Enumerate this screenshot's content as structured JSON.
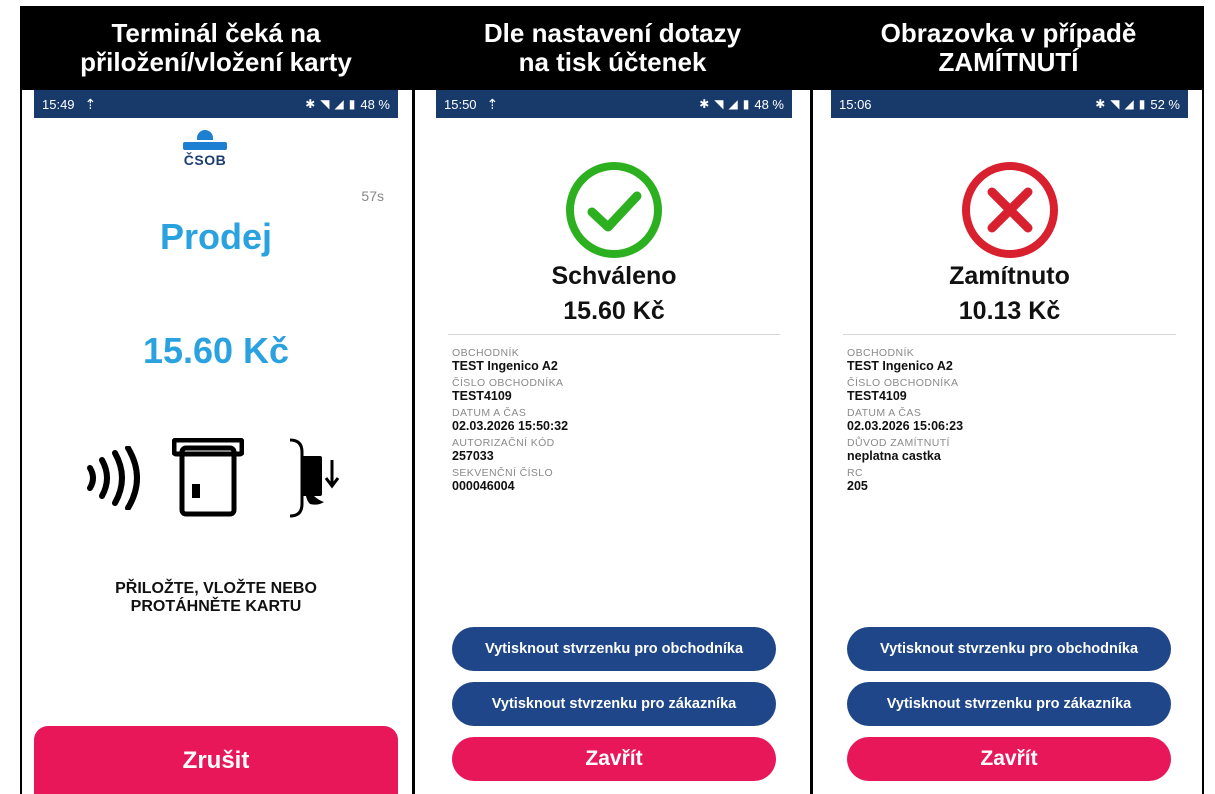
{
  "headers": {
    "col1": [
      "Terminál čeká na",
      "přiložení/vložení karty"
    ],
    "col2": [
      "Dle nastavení dotazy",
      "na tisk účtenek"
    ],
    "col3": [
      "Obrazovka v případě",
      "ZAMÍTNUTÍ"
    ]
  },
  "screen1": {
    "status": {
      "time": "15:49",
      "battery": "48 %"
    },
    "logo_text": "ČSOB",
    "timer": "57s",
    "title": "Prodej",
    "amount": "15.60 Kč",
    "instruction_line1": "PŘILOŽTE, VLOŽTE NEBO",
    "instruction_line2": "PROTÁHNĚTE KARTU",
    "cancel_label": "Zrušit"
  },
  "screen2": {
    "status": {
      "time": "15:50",
      "battery": "48 %"
    },
    "result_title": "Schváleno",
    "amount": "15.60 Kč",
    "fields": [
      {
        "label": "OBCHODNÍK",
        "value": "TEST Ingenico A2"
      },
      {
        "label": "ČÍSLO OBCHODNÍKA",
        "value": "TEST4109"
      },
      {
        "label": "DATUM A ČAS",
        "value": "02.03.2026 15:50:32"
      },
      {
        "label": "AUTORIZAČNÍ KÓD",
        "value": "257033"
      },
      {
        "label": "SEKVENČNÍ ČÍSLO",
        "value": "000046004"
      }
    ],
    "print_merchant_label": "Vytisknout stvrzenku pro obchodníka",
    "print_customer_label": "Vytisknout stvrzenku pro zákazníka",
    "close_label": "Zavřít"
  },
  "screen3": {
    "status": {
      "time": "15:06",
      "battery": "52 %"
    },
    "result_title": "Zamítnuto",
    "amount": "10.13 Kč",
    "fields": [
      {
        "label": "OBCHODNÍK",
        "value": "TEST Ingenico A2"
      },
      {
        "label": "ČÍSLO OBCHODNÍKA",
        "value": "TEST4109"
      },
      {
        "label": "DATUM A ČAS",
        "value": "02.03.2026 15:06:23"
      },
      {
        "label": "DŮVOD ZAMÍTNUTÍ",
        "value": "neplatna castka"
      },
      {
        "label": "RC",
        "value": "205"
      }
    ],
    "print_merchant_label": "Vytisknout stvrzenku pro obchodníka",
    "print_customer_label": "Vytisknout stvrzenku pro zákazníka",
    "close_label": "Zavřít"
  },
  "colors": {
    "status_bar": "#173a6b",
    "accent_blue": "#2aa2e0",
    "button_blue": "#1f4688",
    "button_pink": "#e8175a",
    "success_green": "#2db020",
    "error_red": "#d8202f"
  },
  "icons": {
    "screen1": [
      "upload-icon",
      "bluetooth-icon",
      "wifi-icon",
      "signal-icon",
      "battery-icon",
      "csob-logo-icon",
      "contactless-icon",
      "card-insert-icon",
      "card-swipe-icon"
    ],
    "screen2": [
      "upload-icon",
      "bluetooth-icon",
      "wifi-icon",
      "signal-icon",
      "battery-icon",
      "check-circle-icon"
    ],
    "screen3": [
      "bluetooth-icon",
      "wifi-icon",
      "signal-icon",
      "battery-icon",
      "x-circle-icon"
    ]
  }
}
